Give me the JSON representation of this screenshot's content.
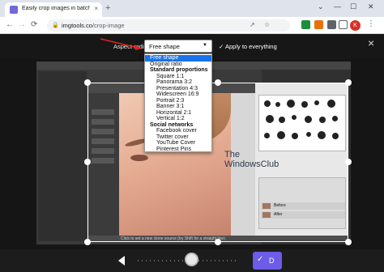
{
  "browser": {
    "tab_title": "Easily crop images in batch - img",
    "tab_close": "×",
    "new_tab": "+",
    "window_controls": [
      "⌄",
      "—",
      "☐",
      "✕"
    ],
    "url_host": "imgtools.co",
    "url_path": "/crop-image",
    "nav": {
      "back": "←",
      "forward": "→",
      "reload": "⟳"
    },
    "avatar_letter": "K",
    "colors": {
      "tab_strip": "#dfe3eb",
      "favicon": "#6f6ad9",
      "avatar": "#d93025"
    }
  },
  "editor": {
    "aspect_ratio_label": "Aspect radio:",
    "selected_option": "Free shape",
    "apply_label": "Apply to everything",
    "apply_icon": "✓",
    "close_icon": "×",
    "dropdown": [
      {
        "label": "Free shape",
        "selected": true,
        "group": false
      },
      {
        "label": "Original ratio",
        "selected": false,
        "group": false
      },
      {
        "label": "Standard proportions",
        "selected": false,
        "group": true
      },
      {
        "label": "Square 1:1",
        "selected": false,
        "group": false
      },
      {
        "label": "Panorama 3:2",
        "selected": false,
        "group": false
      },
      {
        "label": "Presentation 4:3",
        "selected": false,
        "group": false
      },
      {
        "label": "Widescreen 16:9",
        "selected": false,
        "group": false
      },
      {
        "label": "Portrait 2:3",
        "selected": false,
        "group": false
      },
      {
        "label": "Banner 3:1",
        "selected": false,
        "group": false
      },
      {
        "label": "Horizontal 2:1",
        "selected": false,
        "group": false
      },
      {
        "label": "Vertical 1:2",
        "selected": false,
        "group": false
      },
      {
        "label": "Social networks",
        "selected": false,
        "group": true
      },
      {
        "label": "Facebook cover",
        "selected": false,
        "group": false
      },
      {
        "label": "Twitter cover",
        "selected": false,
        "group": false
      },
      {
        "label": "YouTube Cover",
        "selected": false,
        "group": false
      },
      {
        "label": "Pinterest Pins",
        "selected": false,
        "group": false
      }
    ],
    "accent": "#1a73e8"
  },
  "canvas_image": {
    "watermark_line1": "The",
    "watermark_line2": "WindowsClub",
    "status_text": "Click to set a new clone source (try Shift for a straight line)",
    "layers": [
      "Before",
      "After"
    ]
  },
  "bottom_bar": {
    "prev_icon": "◀",
    "done_label": "D",
    "done_icon": "✓",
    "done_color": "#6c5ce7"
  }
}
